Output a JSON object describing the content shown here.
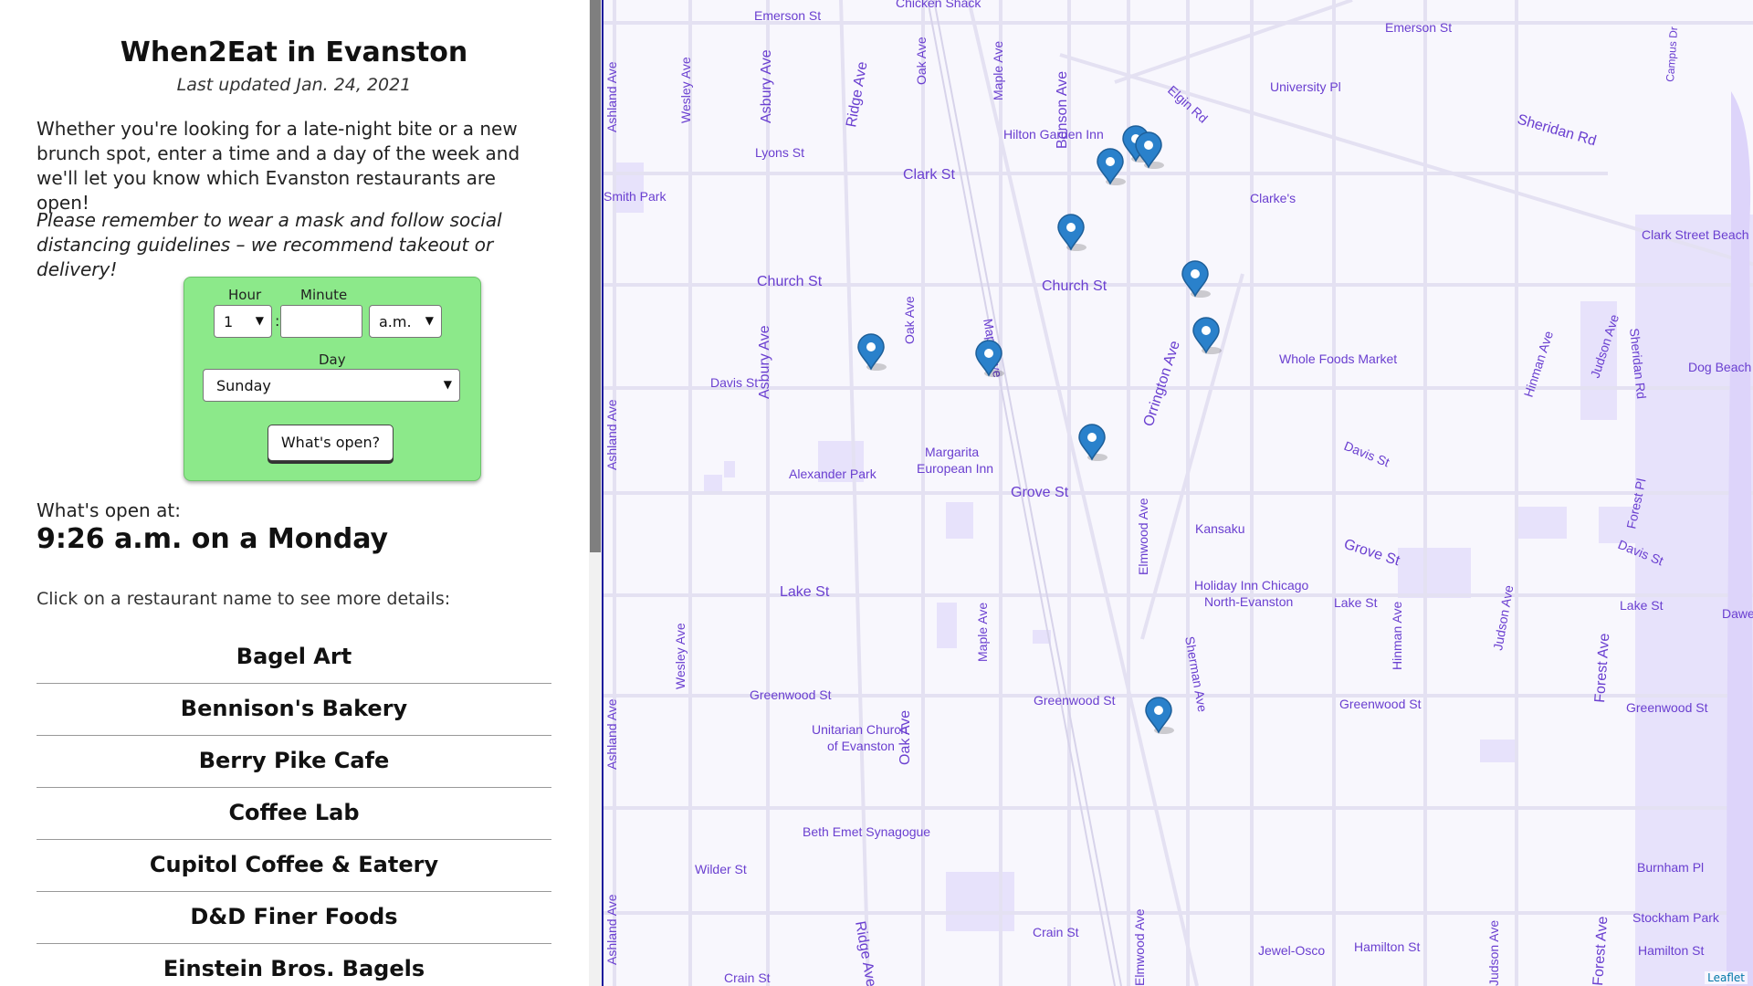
{
  "app": {
    "title": "When2Eat in Evanston",
    "updated": "Last updated Jan. 24, 2021",
    "intro": "Whether you're looking for a late-night bite or a new brunch spot, enter a time and a day of the week and we'll let you know which Evanston restaurants are open!",
    "note": "Please remember to wear a mask and follow social distancing guidelines – we recommend takeout or delivery!"
  },
  "form": {
    "hour_label": "Hour",
    "minute_label": "Minute",
    "hour_value": "1",
    "minute_value": "",
    "colon": ":",
    "ampm_value": "a.m.",
    "day_label": "Day",
    "day_value": "Sunday",
    "submit_label": "What's open?"
  },
  "results": {
    "open_at_label": "What's open at:",
    "open_time": "9:26 a.m. on a Monday",
    "hint": "Click on a restaurant name to see more details:",
    "restaurants": [
      "Bagel Art",
      "Bennison's Bakery",
      "Berry Pike Cafe",
      "Coffee Lab",
      "Cupitol Coffee & Eatery",
      "D&D Finer Foods",
      "Einstein Bros. Bagels"
    ]
  },
  "map": {
    "attribution": "Leaflet",
    "labels": {
      "emerson_st_w": "Emerson St",
      "emerson_st_e": "Emerson St",
      "chicken_shack": "Chicken Shack",
      "university_pl": "University Pl",
      "sheridan_rd": "Sheridan Rd",
      "elgin_rd": "Elgin Rd",
      "hilton": "Hilton Garden Inn",
      "lyons_st": "Lyons St",
      "clark_st": "Clark St",
      "smith_park": "Smith Park",
      "clarkes": "Clarke's",
      "clark_beach": "Clark Street Beach",
      "church_st_w": "Church St",
      "church_st_e": "Church St",
      "whole_foods": "Whole Foods Market",
      "dog_beach": "Dog Beach",
      "davis_st_w": "Davis St",
      "davis_st_e": "Davis St",
      "davis_st_far": "Davis St",
      "margarita": "Margarita",
      "european_inn": "European Inn",
      "alexander_park": "Alexander Park",
      "grove_st": "Grove St",
      "grove_st_e": "Grove St",
      "kansaku": "Kansaku",
      "holiday_inn": "Holiday Inn Chicago",
      "north_evanston": "North-Evanston",
      "lake_st_w": "Lake St",
      "lake_st_m": "Lake St",
      "lake_st_e": "Lake St",
      "dawes": "Dawes",
      "greenwood_w": "Greenwood St",
      "greenwood_m": "Greenwood St",
      "greenwood_e": "Greenwood St",
      "greenwood_far": "Greenwood St",
      "unitarian": "Unitarian Church",
      "of_evanston": "of Evanston",
      "beth_emet": "Beth Emet Synagogue",
      "wilder_st": "Wilder St",
      "burnham_pl": "Burnham Pl",
      "stockham_park": "Stockham Park",
      "crain_st": "Crain St",
      "crain_st_w": "Crain St",
      "jewel": "Jewel-Osco",
      "hamilton_st": "Hamilton St",
      "hamilton_st_e": "Hamilton St",
      "ashland_1": "Ashland Ave",
      "ashland_2": "Ashland Ave",
      "ashland_3": "Ashland Ave",
      "ashland_4": "Ashland Ave",
      "wesley_1": "Wesley Ave",
      "wesley_2": "Wesley Ave",
      "asbury_1": "Asbury Ave",
      "asbury_2": "Asbury Ave",
      "ridge_1": "Ridge Ave",
      "ridge_2": "Ridge Ave",
      "oak_1": "Oak Ave",
      "oak_2": "Oak Ave",
      "oak_3": "Oak Ave",
      "maple_1": "Maple Ave",
      "maple_2": "Maple Ave",
      "maple_3": "Maple Ave",
      "benson": "Benson Ave",
      "elmwood_1": "Elmwood Ave",
      "elmwood_2": "Elmwood Ave",
      "sherman": "Sherman Ave",
      "orrington": "Orrington Ave",
      "hinman_1": "Hinman Ave",
      "hinman_2": "Hinman Ave",
      "judson_1": "Judson Ave",
      "judson_2": "Judson Ave",
      "judson_3": "Judson Ave",
      "forest_1": "Forest Ave",
      "forest_2": "Forest Pl",
      "forest_3": "Forest Ave",
      "sheridan_rd_v": "Sheridan Rd",
      "campus_dr": "Campus Dr"
    },
    "markers": [
      "restaurant",
      "restaurant",
      "restaurant",
      "restaurant",
      "restaurant",
      "restaurant",
      "restaurant",
      "restaurant",
      "restaurant",
      "restaurant"
    ],
    "colors": {
      "marker": "#2a81cb",
      "label": "#6a3fd0",
      "street": "#e6e3f1",
      "park": "#e5defa"
    }
  }
}
